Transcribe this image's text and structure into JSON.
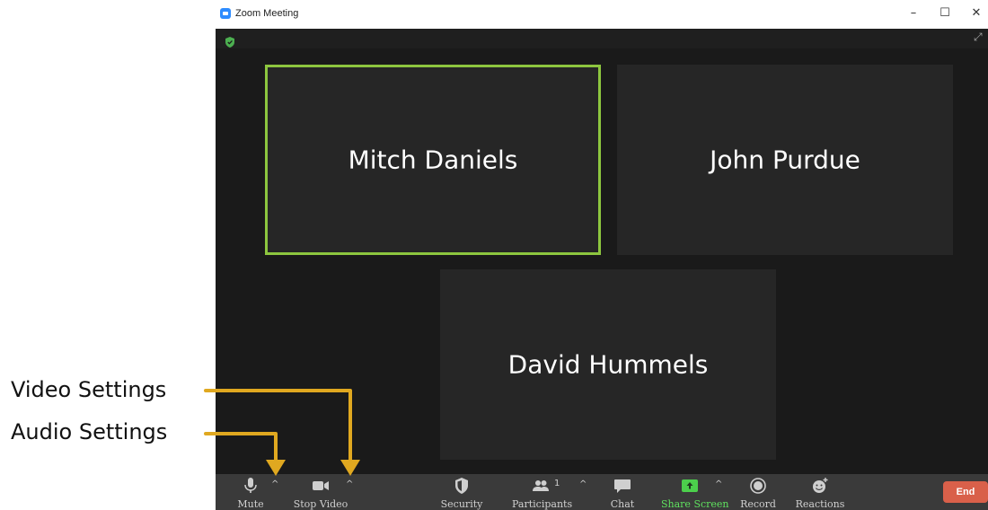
{
  "window": {
    "title": "Zoom Meeting",
    "minimize": "–",
    "maximize": "☐",
    "close": "✕"
  },
  "tiles": [
    {
      "name": "Mitch Daniels",
      "active": true
    },
    {
      "name": "John Purdue",
      "active": false
    },
    {
      "name": "David Hummels",
      "active": false
    }
  ],
  "toolbar": {
    "mute": "Mute",
    "stop_video": "Stop Video",
    "security": "Security",
    "participants": "Participants",
    "participants_count": "1",
    "chat": "Chat",
    "share_screen": "Share Screen",
    "record": "Record",
    "reactions": "Reactions",
    "end": "End",
    "caret": "^"
  },
  "annotations": {
    "video_settings": "Video Settings",
    "audio_settings": "Audio Settings"
  },
  "colors": {
    "active_border": "#8dc63f",
    "end_button": "#d9604a",
    "annotation_arrow": "#e0a820",
    "share_green": "#5fe05f"
  }
}
